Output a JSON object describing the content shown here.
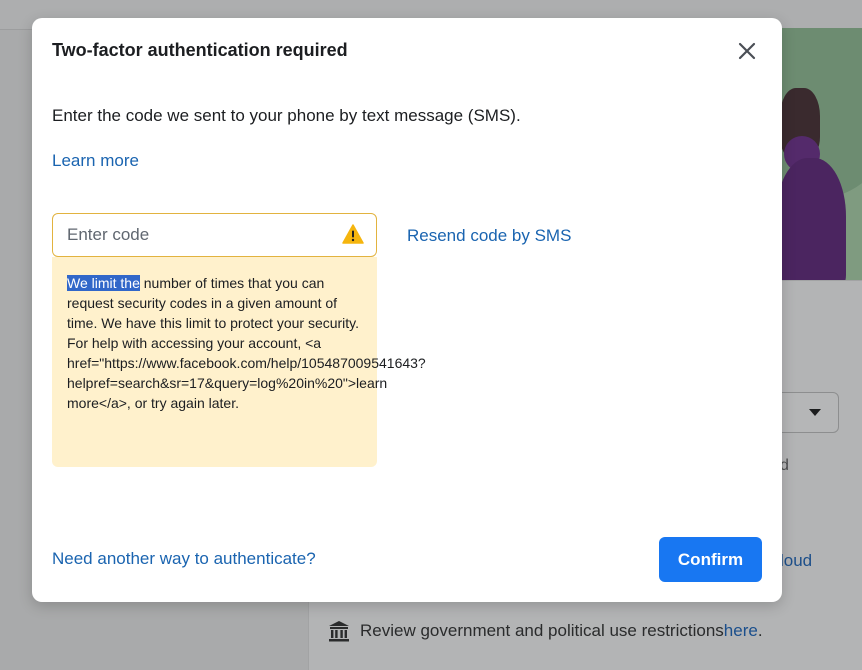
{
  "background": {
    "fragment_d": "d",
    "fragment_loud": "loud",
    "review_text": "Review government and political use restrictions ",
    "review_link": "here",
    "review_period": ".",
    "review_icon": "bank-icon"
  },
  "dialog": {
    "title": "Two-factor authentication required",
    "close_icon": "close-icon",
    "instructions": "Enter the code we sent to your phone by text message (SMS).",
    "learn_more": "Learn more",
    "code_input": {
      "placeholder": "Enter code",
      "value": ""
    },
    "warning_icon": "warning-triangle-icon",
    "warning_highlight": "We limit the",
    "warning_rest": " number of times that you can request security codes in a given amount of time. We have this limit to protect your security. For help with accessing your account, <a href=\"https://www.facebook.com/help/105487009541643?helpref=search&sr=17&query=log%20in%20\">learn more</a>, or try again later.",
    "resend_link": "Resend code by SMS",
    "another_way": "Need another way to authenticate?",
    "confirm_label": "Confirm"
  },
  "colors": {
    "primary": "#1877f2",
    "link": "#1a64b0",
    "warning_bg": "#fff1cc",
    "warning_border": "#e2b33f",
    "highlight": "#3167c9"
  }
}
